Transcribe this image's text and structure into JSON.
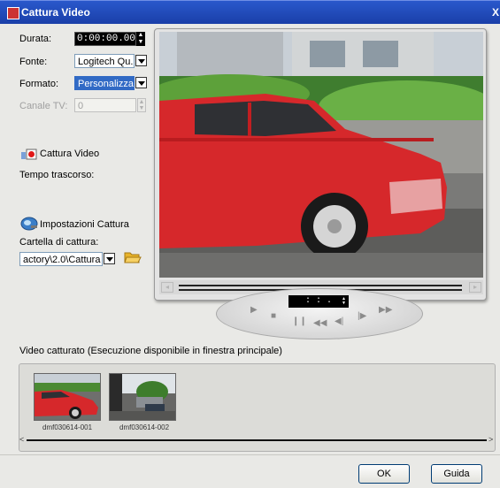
{
  "window": {
    "title": "Cattura Video",
    "close_label": "X"
  },
  "form": {
    "duration_label": "Durata:",
    "duration_value": "0:00:00.00",
    "source_label": "Fonte:",
    "source_value": "Logitech Qu...",
    "format_label": "Formato:",
    "format_value": "Personalizza",
    "tv_channel_label": "Canale TV:",
    "tv_channel_value": "0"
  },
  "capture": {
    "capture_video_label": "Cattura Video",
    "elapsed_label": "Tempo trascorso:",
    "settings_label": "Impostazioni Cattura",
    "folder_label": "Cartella di cattura:",
    "folder_value": "actory\\2.0\\Cattura"
  },
  "player": {
    "timecode": ":  :  .",
    "controls": [
      "▶",
      "■",
      "❙❙",
      "◀◀",
      "◀|",
      "|▶",
      "▶▶"
    ]
  },
  "captured": {
    "header": "Video catturato (Esecuzione disponibile in finestra principale)",
    "items": [
      {
        "name": "dmf030614-001"
      },
      {
        "name": "dmf030614-002"
      }
    ]
  },
  "buttons": {
    "ok": "OK",
    "help": "Guida"
  },
  "colors": {
    "titlebar": "#2a58cc",
    "car": "#d6282b",
    "selection": "#316ac5"
  }
}
